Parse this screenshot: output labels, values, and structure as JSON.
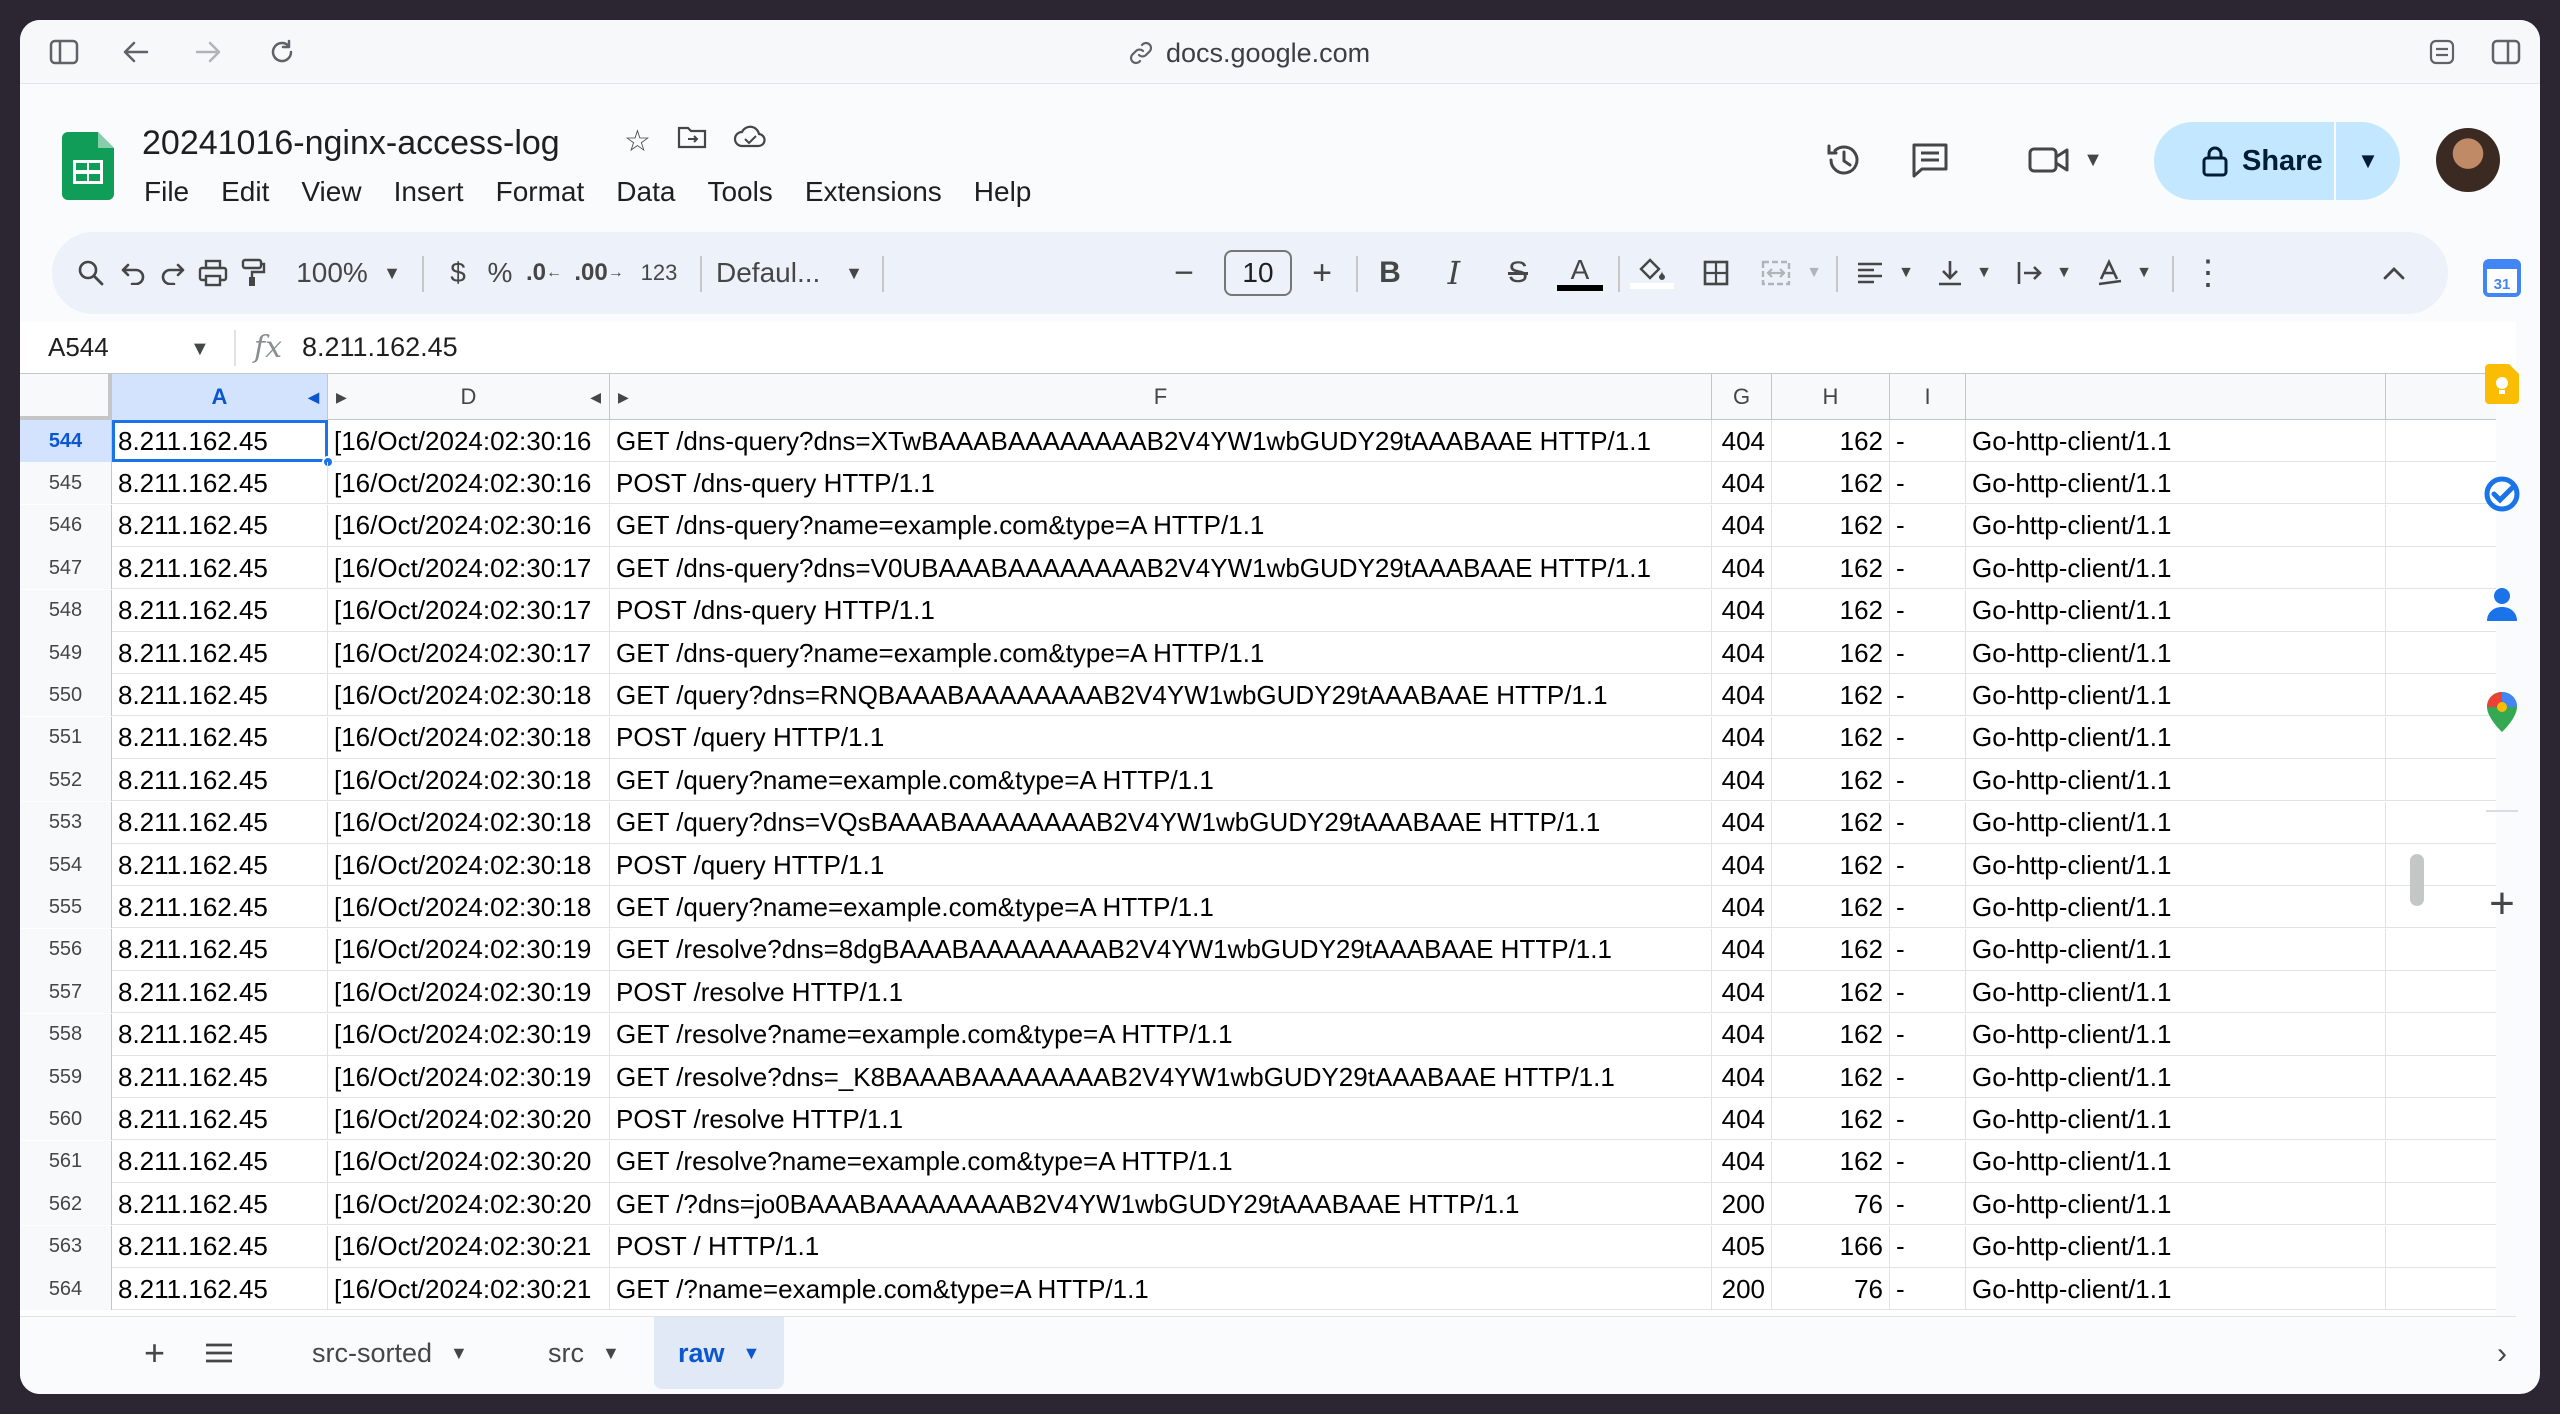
{
  "browser": {
    "url": "docs.google.com"
  },
  "doc": {
    "title": "20241016-nginx-access-log"
  },
  "menu": [
    "File",
    "Edit",
    "View",
    "Insert",
    "Format",
    "Data",
    "Tools",
    "Extensions",
    "Help"
  ],
  "share": {
    "label": "Share"
  },
  "toolbar": {
    "zoom": "100%",
    "currency": "$",
    "percent": "%",
    "dec_decrease": ".0",
    "dec_increase": ".00",
    "number_format": "123",
    "font": "Defaul...",
    "font_size": "10",
    "bold": "B",
    "italic": "I",
    "strike": "S",
    "text_color": "A"
  },
  "formula_bar": {
    "cell_ref": "A544",
    "value": "8.211.162.45"
  },
  "columns": [
    "A",
    "D",
    "F",
    "G",
    "H",
    "I"
  ],
  "rows": [
    {
      "n": "544",
      "a": "8.211.162.45",
      "d": "[16/Oct/2024:02:30:16",
      "f": "GET /dns-query?dns=XTwBAAABAAAAAAAAB2V4YW1wbGUDY29tAAABAAE HTTP/1.1",
      "g": "404",
      "h": "162",
      "i": "-",
      "j": "Go-http-client/1.1"
    },
    {
      "n": "545",
      "a": "8.211.162.45",
      "d": "[16/Oct/2024:02:30:16",
      "f": "POST /dns-query HTTP/1.1",
      "g": "404",
      "h": "162",
      "i": "-",
      "j": "Go-http-client/1.1"
    },
    {
      "n": "546",
      "a": "8.211.162.45",
      "d": "[16/Oct/2024:02:30:16",
      "f": "GET /dns-query?name=example.com&type=A HTTP/1.1",
      "g": "404",
      "h": "162",
      "i": "-",
      "j": "Go-http-client/1.1"
    },
    {
      "n": "547",
      "a": "8.211.162.45",
      "d": "[16/Oct/2024:02:30:17",
      "f": "GET /dns-query?dns=V0UBAAABAAAAAAAAB2V4YW1wbGUDY29tAAABAAE HTTP/1.1",
      "g": "404",
      "h": "162",
      "i": "-",
      "j": "Go-http-client/1.1"
    },
    {
      "n": "548",
      "a": "8.211.162.45",
      "d": "[16/Oct/2024:02:30:17",
      "f": "POST /dns-query HTTP/1.1",
      "g": "404",
      "h": "162",
      "i": "-",
      "j": "Go-http-client/1.1"
    },
    {
      "n": "549",
      "a": "8.211.162.45",
      "d": "[16/Oct/2024:02:30:17",
      "f": "GET /dns-query?name=example.com&type=A HTTP/1.1",
      "g": "404",
      "h": "162",
      "i": "-",
      "j": "Go-http-client/1.1"
    },
    {
      "n": "550",
      "a": "8.211.162.45",
      "d": "[16/Oct/2024:02:30:18",
      "f": "GET /query?dns=RNQBAAABAAAAAAAAB2V4YW1wbGUDY29tAAABAAE HTTP/1.1",
      "g": "404",
      "h": "162",
      "i": "-",
      "j": "Go-http-client/1.1"
    },
    {
      "n": "551",
      "a": "8.211.162.45",
      "d": "[16/Oct/2024:02:30:18",
      "f": "POST /query HTTP/1.1",
      "g": "404",
      "h": "162",
      "i": "-",
      "j": "Go-http-client/1.1"
    },
    {
      "n": "552",
      "a": "8.211.162.45",
      "d": "[16/Oct/2024:02:30:18",
      "f": "GET /query?name=example.com&type=A HTTP/1.1",
      "g": "404",
      "h": "162",
      "i": "-",
      "j": "Go-http-client/1.1"
    },
    {
      "n": "553",
      "a": "8.211.162.45",
      "d": "[16/Oct/2024:02:30:18",
      "f": "GET /query?dns=VQsBAAABAAAAAAAAB2V4YW1wbGUDY29tAAABAAE HTTP/1.1",
      "g": "404",
      "h": "162",
      "i": "-",
      "j": "Go-http-client/1.1"
    },
    {
      "n": "554",
      "a": "8.211.162.45",
      "d": "[16/Oct/2024:02:30:18",
      "f": "POST /query HTTP/1.1",
      "g": "404",
      "h": "162",
      "i": "-",
      "j": "Go-http-client/1.1"
    },
    {
      "n": "555",
      "a": "8.211.162.45",
      "d": "[16/Oct/2024:02:30:18",
      "f": "GET /query?name=example.com&type=A HTTP/1.1",
      "g": "404",
      "h": "162",
      "i": "-",
      "j": "Go-http-client/1.1"
    },
    {
      "n": "556",
      "a": "8.211.162.45",
      "d": "[16/Oct/2024:02:30:19",
      "f": "GET /resolve?dns=8dgBAAABAAAAAAAAB2V4YW1wbGUDY29tAAABAAE HTTP/1.1",
      "g": "404",
      "h": "162",
      "i": "-",
      "j": "Go-http-client/1.1"
    },
    {
      "n": "557",
      "a": "8.211.162.45",
      "d": "[16/Oct/2024:02:30:19",
      "f": "POST /resolve HTTP/1.1",
      "g": "404",
      "h": "162",
      "i": "-",
      "j": "Go-http-client/1.1"
    },
    {
      "n": "558",
      "a": "8.211.162.45",
      "d": "[16/Oct/2024:02:30:19",
      "f": "GET /resolve?name=example.com&type=A HTTP/1.1",
      "g": "404",
      "h": "162",
      "i": "-",
      "j": "Go-http-client/1.1"
    },
    {
      "n": "559",
      "a": "8.211.162.45",
      "d": "[16/Oct/2024:02:30:19",
      "f": "GET /resolve?dns=_K8BAAABAAAAAAAAB2V4YW1wbGUDY29tAAABAAE HTTP/1.1",
      "g": "404",
      "h": "162",
      "i": "-",
      "j": "Go-http-client/1.1"
    },
    {
      "n": "560",
      "a": "8.211.162.45",
      "d": "[16/Oct/2024:02:30:20",
      "f": "POST /resolve HTTP/1.1",
      "g": "404",
      "h": "162",
      "i": "-",
      "j": "Go-http-client/1.1"
    },
    {
      "n": "561",
      "a": "8.211.162.45",
      "d": "[16/Oct/2024:02:30:20",
      "f": "GET /resolve?name=example.com&type=A HTTP/1.1",
      "g": "404",
      "h": "162",
      "i": "-",
      "j": "Go-http-client/1.1"
    },
    {
      "n": "562",
      "a": "8.211.162.45",
      "d": "[16/Oct/2024:02:30:20",
      "f": "GET /?dns=jo0BAAABAAAAAAAAB2V4YW1wbGUDY29tAAABAAE HTTP/1.1",
      "g": "200",
      "h": "76",
      "i": "-",
      "j": "Go-http-client/1.1"
    },
    {
      "n": "563",
      "a": "8.211.162.45",
      "d": "[16/Oct/2024:02:30:21",
      "f": "POST / HTTP/1.1",
      "g": "405",
      "h": "166",
      "i": "-",
      "j": "Go-http-client/1.1"
    },
    {
      "n": "564",
      "a": "8.211.162.45",
      "d": "[16/Oct/2024:02:30:21",
      "f": "GET /?name=example.com&type=A HTTP/1.1",
      "g": "200",
      "h": "76",
      "i": "-",
      "j": "Go-http-client/1.1"
    }
  ],
  "sheets": [
    "src-sorted",
    "src",
    "raw"
  ],
  "active_sheet": "raw",
  "colors": {
    "accent": "#1a73e8",
    "share_bg": "#c2e7ff",
    "selected_header": "#d3e3fd"
  }
}
